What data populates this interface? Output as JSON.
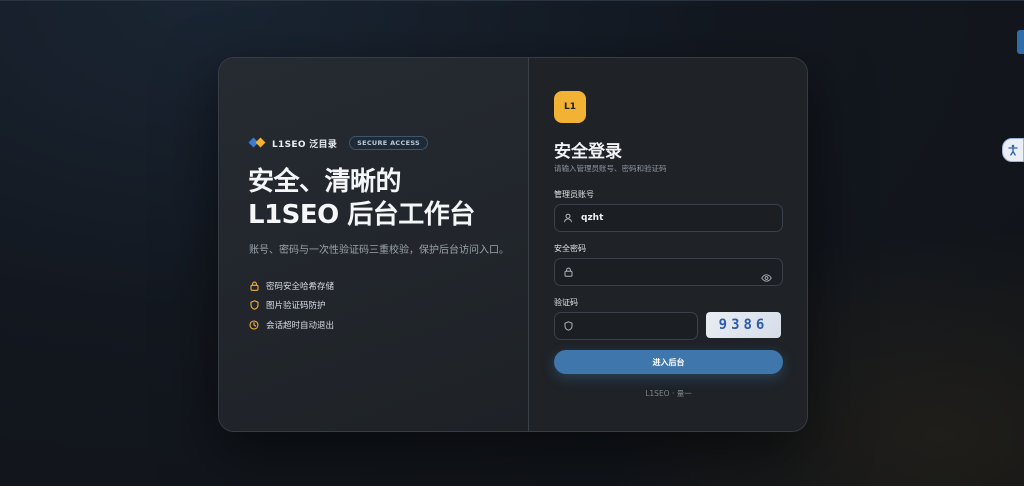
{
  "brand": {
    "name": "L1SEO 泛目录",
    "badge": "SECURE ACCESS"
  },
  "hero": {
    "headline_line1": "安全、清晰的",
    "headline_line2": "L1SEO 后台工作台",
    "subtitle": "账号、密码与一次性验证码三重校验，保护后台访问入口。"
  },
  "features": [
    {
      "icon": "lock-icon",
      "text": "密码安全哈希存储"
    },
    {
      "icon": "shield-icon",
      "text": "图片验证码防护"
    },
    {
      "icon": "clock-icon",
      "text": "会话超时自动退出"
    }
  ],
  "form": {
    "logo_text": "L1",
    "title": "安全登录",
    "subtitle": "请输入管理员账号、密码和验证码",
    "username_label": "管理员账号",
    "username_value": "qzht",
    "password_label": "安全密码",
    "password_value": "",
    "captcha_label": "验证码",
    "captcha_value": "",
    "captcha_text": "9386",
    "submit_label": "进入后台",
    "footer": "L1SEO · 量一"
  },
  "colors": {
    "accent": "#f2b233",
    "primary": "#3f77ad",
    "background": "#131820",
    "card": "#1f2329"
  }
}
